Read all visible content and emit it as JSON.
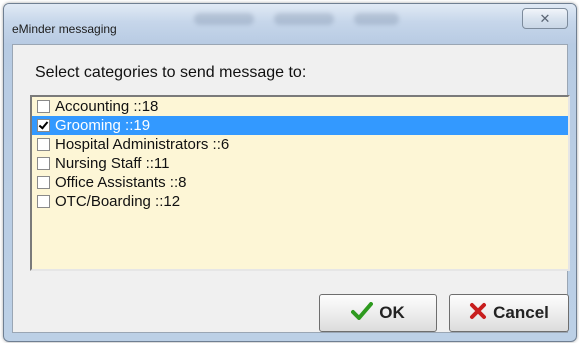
{
  "window": {
    "title": "eMinder messaging",
    "close_glyph": "✕"
  },
  "prompt": "Select categories to send message to:",
  "categories": [
    {
      "label": "Accounting ::18",
      "checked": false,
      "selected": false
    },
    {
      "label": "Grooming ::19",
      "checked": true,
      "selected": true
    },
    {
      "label": "Hospital Administrators ::6",
      "checked": false,
      "selected": false
    },
    {
      "label": "Nursing Staff ::11",
      "checked": false,
      "selected": false
    },
    {
      "label": "Office Assistants ::8",
      "checked": false,
      "selected": false
    },
    {
      "label": "OTC/Boarding ::12",
      "checked": false,
      "selected": false
    }
  ],
  "buttons": {
    "ok_label": "OK",
    "cancel_label": "Cancel",
    "ok_icon": "checkmark-icon",
    "cancel_icon": "x-icon"
  },
  "colors": {
    "list_background": "#fdf6d6",
    "selection": "#3399ff",
    "ok_icon": "#2e9a1f",
    "cancel_icon": "#c81e1e"
  }
}
